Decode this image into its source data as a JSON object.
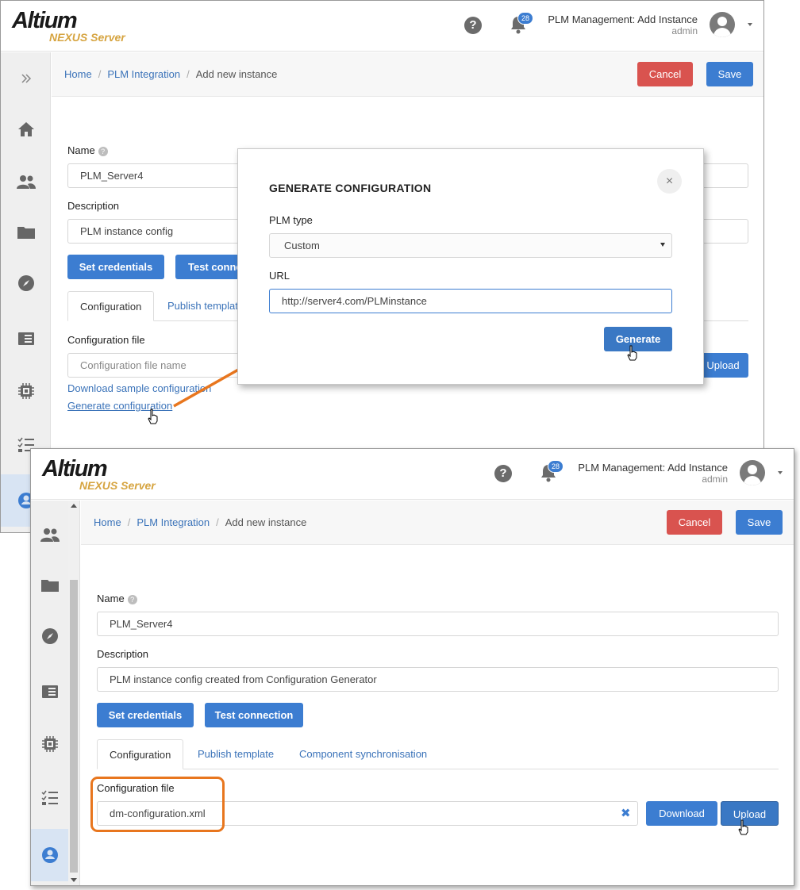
{
  "app": {
    "logo_main": "Altium",
    "logo_sub": "NEXUS Server",
    "help_icon": "?",
    "notification_count": "28",
    "page_title": "PLM Management: Add Instance",
    "user": "admin"
  },
  "breadcrumb": {
    "home": "Home",
    "plm": "PLM Integration",
    "current": "Add new instance",
    "separator": "/"
  },
  "toolbar": {
    "cancel": "Cancel",
    "save": "Save"
  },
  "form_before": {
    "name_label": "Name",
    "name_value": "PLM_Server4",
    "description_label": "Description",
    "description_value": "PLM  instance config",
    "set_credentials": "Set credentials",
    "test_connection_partial": "Test conne",
    "tab_configuration": "Configuration",
    "tab_publish_partial": "Publish templat",
    "config_file_label": "Configuration file",
    "config_file_placeholder": "Configuration file name",
    "upload_partial": "Upload",
    "download_sample": "Download sample configuration",
    "generate_configuration": "Generate configuration"
  },
  "dialog": {
    "title": "GENERATE CONFIGURATION",
    "close": "×",
    "plm_type_label": "PLM type",
    "plm_type_value": "Custom",
    "url_label": "URL",
    "url_value": "http://server4.com/PLMinstance",
    "generate": "Generate"
  },
  "form_after": {
    "name_label": "Name",
    "name_value": "PLM_Server4",
    "description_label": "Description",
    "description_value": "PLM instance config created from Configuration Generator",
    "set_credentials": "Set credentials",
    "test_connection": "Test connection",
    "tabs": [
      "Configuration",
      "Publish template",
      "Component synchronisation"
    ],
    "config_file_label": "Configuration file",
    "config_file_value": "dm-configuration.xml",
    "clear": "✖",
    "download": "Download",
    "upload": "Upload"
  },
  "colors": {
    "primary": "#3c7dd1",
    "danger": "#d9534f",
    "highlight": "#e8761e",
    "logo_sub": "#d6a440",
    "sidebar_active": "#d8e4f3"
  }
}
